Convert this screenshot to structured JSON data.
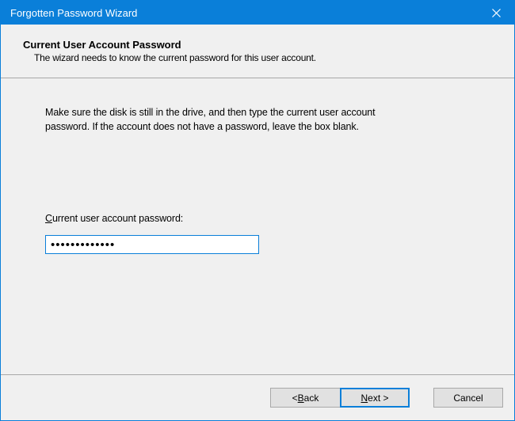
{
  "titlebar": {
    "title": "Forgotten Password Wizard"
  },
  "header": {
    "title": "Current User Account Password",
    "subtitle": "The wizard needs to know the current password for this user account."
  },
  "content": {
    "instruction": "Make sure the disk is still in the drive, and then type the current user account password. If the account does not have a password, leave the box blank.",
    "field_label_prefix": "C",
    "field_label_rest": "urrent user account password:",
    "password_value": "•••••••••••••"
  },
  "buttons": {
    "back_lt": "< ",
    "back_u": "B",
    "back_rest": "ack",
    "next_u": "N",
    "next_rest": "ext >",
    "cancel": "Cancel"
  }
}
